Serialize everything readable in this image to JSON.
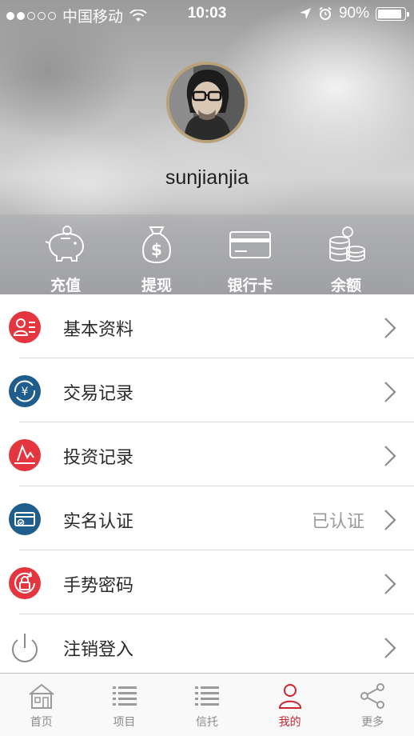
{
  "status_bar": {
    "carrier": "中国移动",
    "time": "10:03",
    "battery": "90%",
    "battery_level": 0.9
  },
  "profile": {
    "username": "sunjianjia"
  },
  "shortcuts": [
    {
      "label": "充值",
      "icon": "piggy-bank-icon"
    },
    {
      "label": "提现",
      "icon": "money-bag-icon"
    },
    {
      "label": "银行卡",
      "icon": "bank-card-icon"
    },
    {
      "label": "余额",
      "icon": "coins-icon"
    }
  ],
  "menu": [
    {
      "label": "基本资料",
      "icon": "profile-card-icon",
      "status": ""
    },
    {
      "label": "交易记录",
      "icon": "yuan-exchange-icon",
      "status": ""
    },
    {
      "label": "投资记录",
      "icon": "investment-icon",
      "status": ""
    },
    {
      "label": "实名认证",
      "icon": "id-card-icon",
      "status": "已认证"
    },
    {
      "label": "手势密码",
      "icon": "gesture-lock-icon",
      "status": ""
    },
    {
      "label": "注销登入",
      "icon": "power-icon",
      "status": ""
    }
  ],
  "tabs": [
    {
      "label": "首页",
      "icon": "home-icon",
      "active": false
    },
    {
      "label": "项目",
      "icon": "list-icon",
      "active": false
    },
    {
      "label": "信托",
      "icon": "list-icon",
      "active": false
    },
    {
      "label": "我的",
      "icon": "person-icon",
      "active": true
    },
    {
      "label": "更多",
      "icon": "share-icon",
      "active": false
    }
  ],
  "colors": {
    "accent_red": "#d0232e",
    "icon_red": "#e5363f",
    "icon_blue": "#1f5d8c",
    "avatar_ring": "#b9a27a"
  }
}
